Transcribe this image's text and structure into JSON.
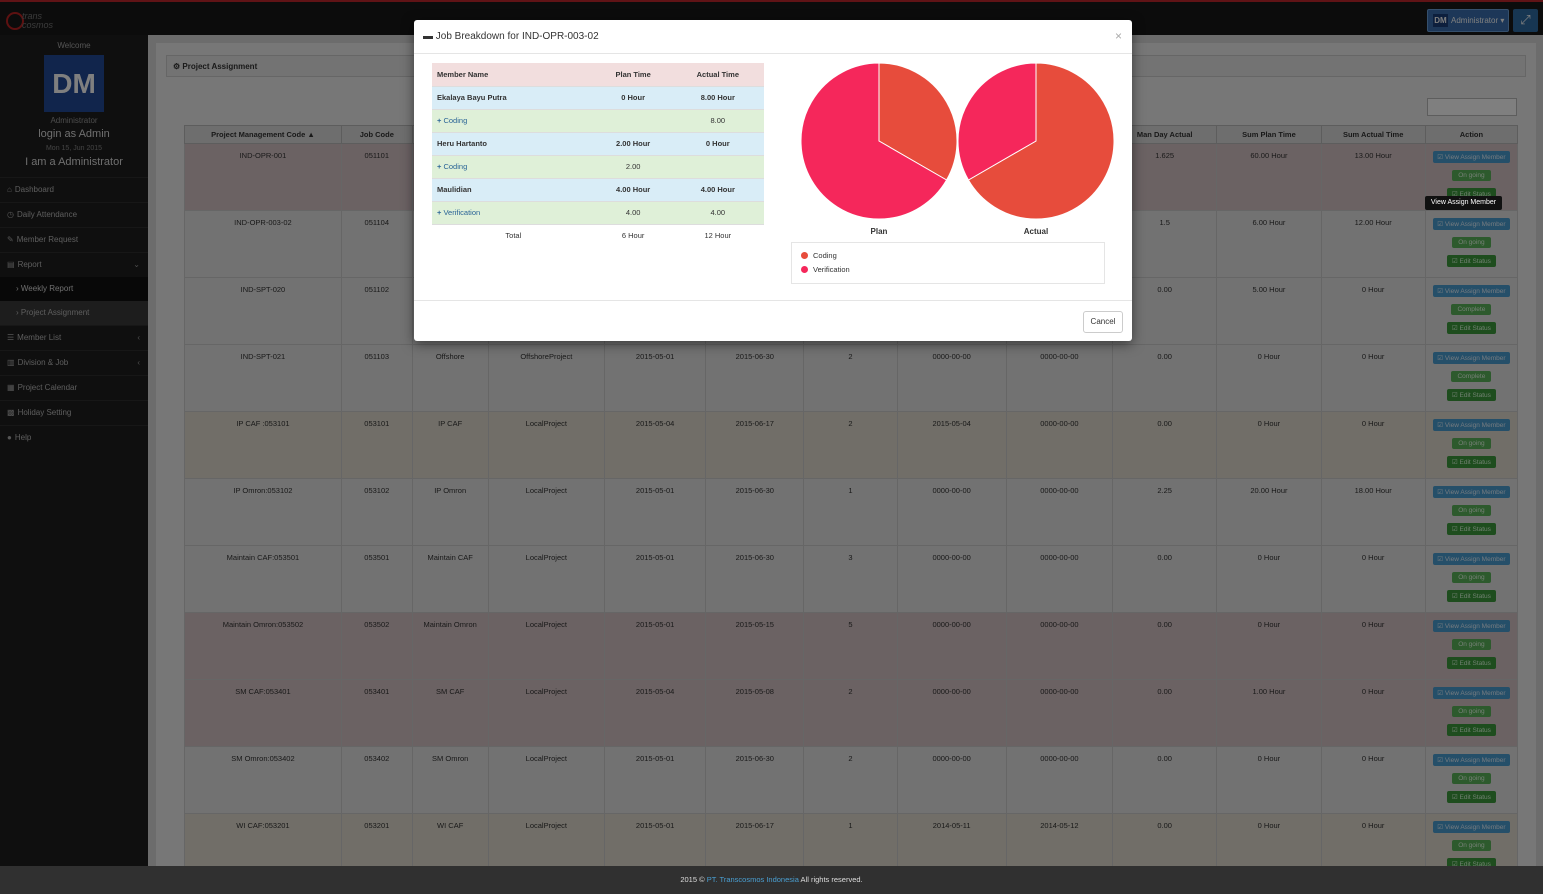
{
  "topbar": {
    "admin_initials": "DM",
    "admin_label": "Administrator ▾",
    "expand_icon": "⤢",
    "logo_text": "trans cosmos"
  },
  "sidebar": {
    "welcome": "Welcome",
    "avatar": "DM",
    "role": "Administrator",
    "login": "login as Admin",
    "date": "Mon 15, Jun 2015",
    "iam": "I am a Administrator",
    "items": [
      {
        "icon": "⌂",
        "label": "Dashboard"
      },
      {
        "icon": "◷",
        "label": "Daily Attendance"
      },
      {
        "icon": "✎",
        "label": "Member Request"
      },
      {
        "icon": "▤",
        "label": "Report",
        "chev": "⌄"
      },
      {
        "icon": "",
        "label": "› Weekly Report",
        "sub": true
      },
      {
        "icon": "",
        "label": "› Project Assignment",
        "sub": true,
        "alt": true
      },
      {
        "icon": "☰",
        "label": "Member List",
        "chev": "‹"
      },
      {
        "icon": "▥",
        "label": "Division & Job",
        "chev": "‹"
      },
      {
        "icon": "▦",
        "label": "Project Calendar"
      },
      {
        "icon": "▩",
        "label": "Holiday Setting"
      },
      {
        "icon": "●",
        "label": "Help"
      }
    ]
  },
  "panel": {
    "title": "⚙ Project Assignment"
  },
  "grid": {
    "headers": [
      "Project Management Code ▲",
      "Job Code",
      "",
      "",
      "",
      "",
      "",
      "",
      "",
      "Man Day Actual",
      "Sum Plan Time",
      "Sum Actual Time",
      "Action"
    ],
    "rows": [
      {
        "cls": "c0",
        "cells": [
          "IND-OPR-001",
          "051101",
          "",
          "",
          "",
          "",
          "",
          "",
          "",
          "1.625",
          "60.00 Hour",
          "13.00 Hour"
        ],
        "status": "On going"
      },
      {
        "cls": "c1",
        "cells": [
          "IND-OPR-003-02",
          "051104",
          "",
          "",
          "",
          "",
          "",
          "",
          "",
          "1.5",
          "6.00 Hour",
          "12.00 Hour"
        ],
        "status": "On going"
      },
      {
        "cls": "c1",
        "cells": [
          "IND-SPT-020",
          "051102",
          "",
          "",
          "",
          "",
          "",
          "",
          "",
          "0.00",
          "5.00 Hour",
          "0 Hour"
        ],
        "status": "Complete"
      },
      {
        "cls": "c1",
        "cells": [
          "IND-SPT-021",
          "051103",
          "Offshore",
          "OffshoreProject",
          "2015-05-01",
          "2015-06-30",
          "2",
          "0000-00-00",
          "0000-00-00",
          "0.00",
          "0 Hour",
          "0 Hour"
        ],
        "status": "Complete"
      },
      {
        "cls": "c2",
        "cells": [
          "IP CAF :053101",
          "053101",
          "IP CAF",
          "LocalProject",
          "2015-05-04",
          "2015-06-17",
          "2",
          "2015-05-04",
          "0000-00-00",
          "0.00",
          "0 Hour",
          "0 Hour"
        ],
        "status": "On going"
      },
      {
        "cls": "c1",
        "cells": [
          "IP Omron:053102",
          "053102",
          "IP Omron",
          "LocalProject",
          "2015-05-01",
          "2015-06-30",
          "1",
          "0000-00-00",
          "0000-00-00",
          "2.25",
          "20.00 Hour",
          "18.00 Hour"
        ],
        "status": "On going"
      },
      {
        "cls": "c1",
        "cells": [
          "Maintain CAF:053501",
          "053501",
          "Maintain CAF",
          "LocalProject",
          "2015-05-01",
          "2015-06-30",
          "3",
          "0000-00-00",
          "0000-00-00",
          "0.00",
          "0 Hour",
          "0 Hour"
        ],
        "status": "On going"
      },
      {
        "cls": "c0",
        "cells": [
          "Maintain Omron:053502",
          "053502",
          "Maintain Omron",
          "LocalProject",
          "2015-05-01",
          "2015-05-15",
          "5",
          "0000-00-00",
          "0000-00-00",
          "0.00",
          "0 Hour",
          "0 Hour"
        ],
        "status": "On going"
      },
      {
        "cls": "c0",
        "cells": [
          "SM CAF:053401",
          "053401",
          "SM CAF",
          "LocalProject",
          "2015-05-04",
          "2015-05-08",
          "2",
          "0000-00-00",
          "0000-00-00",
          "0.00",
          "1.00 Hour",
          "0 Hour"
        ],
        "status": "On going"
      },
      {
        "cls": "c1",
        "cells": [
          "SM Omron:053402",
          "053402",
          "SM Omron",
          "LocalProject",
          "2015-05-01",
          "2015-06-30",
          "2",
          "0000-00-00",
          "0000-00-00",
          "0.00",
          "0 Hour",
          "0 Hour"
        ],
        "status": "On going"
      },
      {
        "cls": "c2",
        "cells": [
          "WI CAF:053201",
          "053201",
          "WI CAF",
          "LocalProject",
          "2015-05-01",
          "2015-06-17",
          "1",
          "2014-05-11",
          "2014-05-12",
          "0.00",
          "0 Hour",
          "0 Hour"
        ],
        "status": "On going"
      }
    ],
    "view_label": "☑ View Assign Member",
    "edit_label": "☑ Edit Status"
  },
  "tooltip": "View Assign Member",
  "footer": {
    "prefix": "2015 © ",
    "company": "PT. Transcosmos Indonesia",
    "suffix": " All rights reserved."
  },
  "modal": {
    "title": "Job Breakdown for IND-OPR-003-02",
    "close": "×",
    "headers": [
      "Member Name",
      "Plan Time",
      "Actual Time"
    ],
    "rows": [
      {
        "type": "member",
        "name": "Ekalaya Bayu Putra",
        "plan": "0 Hour",
        "actual": "8.00 Hour"
      },
      {
        "type": "job",
        "name": "Coding",
        "plan": "",
        "actual": "8.00"
      },
      {
        "type": "member",
        "name": "Heru Hartanto",
        "plan": "2.00 Hour",
        "actual": "0 Hour"
      },
      {
        "type": "job",
        "name": "Coding",
        "plan": "2.00",
        "actual": ""
      },
      {
        "type": "member",
        "name": "Maulidian",
        "plan": "4.00 Hour",
        "actual": "4.00 Hour"
      },
      {
        "type": "job",
        "name": "Verification",
        "plan": "4.00",
        "actual": "4.00"
      }
    ],
    "total": {
      "label": "Total",
      "plan": "6 Hour",
      "actual": "12 Hour"
    },
    "cancel": "Cancel",
    "legend": [
      {
        "label": "Coding",
        "color": "#e74c3c"
      },
      {
        "label": "Verification",
        "color": "#f5275b"
      }
    ]
  },
  "chart_data": [
    {
      "type": "pie",
      "title": "Plan",
      "categories": [
        "Coding",
        "Verification"
      ],
      "values": [
        2,
        4
      ],
      "colors": [
        "#e74c3c",
        "#f5275b"
      ]
    },
    {
      "type": "pie",
      "title": "Actual",
      "categories": [
        "Coding",
        "Verification"
      ],
      "values": [
        8,
        4
      ],
      "colors": [
        "#e74c3c",
        "#f5275b"
      ]
    }
  ]
}
